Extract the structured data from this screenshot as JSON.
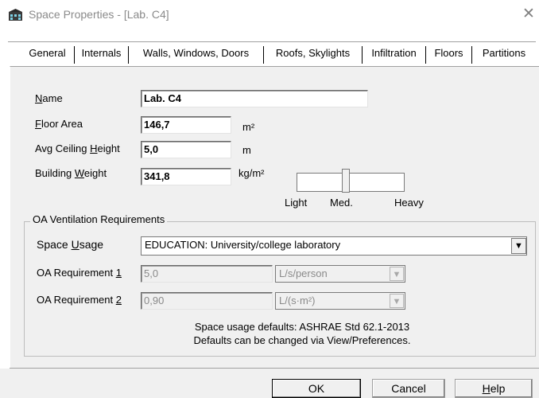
{
  "window": {
    "title": "Space Properties - [Lab. C4]",
    "icon": "app-icon",
    "close_glyph": "✕"
  },
  "tabs": [
    {
      "label": "General",
      "selected": true
    },
    {
      "label": "Internals"
    },
    {
      "label": "Walls, Windows, Doors"
    },
    {
      "label": "Roofs, Skylights"
    },
    {
      "label": "Infiltration"
    },
    {
      "label": "Floors"
    },
    {
      "label": "Partitions"
    }
  ],
  "general": {
    "name": {
      "label_prefix": "",
      "label_ul": "N",
      "label_rest": "ame",
      "value": "Lab. C4"
    },
    "floor_area": {
      "label_ul": "F",
      "label_rest": "loor Area",
      "value": "146,7",
      "unit": "m²"
    },
    "ceiling_height": {
      "label_prefix": "Avg Ceiling ",
      "label_ul": "H",
      "label_rest": "eight",
      "value": "5,0",
      "unit": "m"
    },
    "building_weight": {
      "label_prefix": "Building ",
      "label_ul": "W",
      "label_rest": "eight",
      "value": "341,8",
      "unit": "kg/m²",
      "scale": {
        "light": "Light",
        "med": "Med.",
        "heavy": "Heavy",
        "level": 0.45
      }
    }
  },
  "oa": {
    "group_title": "OA Ventilation Requirements",
    "space_usage": {
      "label_prefix": "Space ",
      "label_ul": "U",
      "label_rest": "sage",
      "value": "EDUCATION: University/college laboratory"
    },
    "req1": {
      "label_prefix": "OA Requirement ",
      "label_ul": "1",
      "value": "5,0",
      "unit": "L/s/person"
    },
    "req2": {
      "label_prefix": "OA Requirement ",
      "label_ul": "2",
      "value": "0,90",
      "unit": "L/(s·m²)"
    },
    "note_line1": "Space usage defaults: ASHRAE Std 62.1-2013",
    "note_line2": "Defaults can be changed via View/Preferences."
  },
  "buttons": {
    "ok": "OK",
    "cancel": "Cancel",
    "help_ul": "H",
    "help_rest": "elp"
  },
  "glyphs": {
    "dropdown": "▼"
  }
}
